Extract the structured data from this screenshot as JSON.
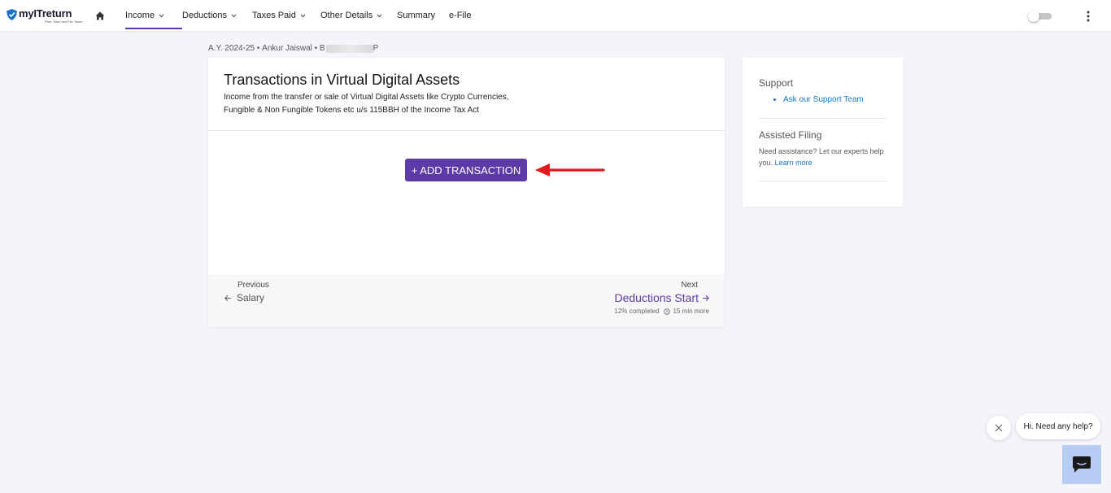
{
  "brand": {
    "name": "myITreturn",
    "tagline": "Plan, Save and File Taxes",
    "accent": "#5c3aa8"
  },
  "nav": {
    "home_icon": "home-icon",
    "items": [
      {
        "label": "Income",
        "dropdown": true,
        "active": true
      },
      {
        "label": "Deductions",
        "dropdown": true
      },
      {
        "label": "Taxes Paid",
        "dropdown": true
      },
      {
        "label": "Other Details",
        "dropdown": true
      },
      {
        "label": "Summary",
        "dropdown": false
      },
      {
        "label": "e-File",
        "dropdown": false
      }
    ],
    "toggle_on": false,
    "menu_icon": "more-vertical-icon"
  },
  "breadcrumb": {
    "year": "A.Y. 2024-25",
    "name": "Ankur Jaiswal",
    "pan_prefix": "B",
    "pan_suffix": "P"
  },
  "card": {
    "title": "Transactions in Virtual Digital Assets",
    "subtitle": "Income from the transfer or sale of Virtual Digital Assets like Crypto Currencies, Fungible & Non Fungible Tokens etc u/s 115BBH of the Income Tax Act",
    "add_button": "+ ADD TRANSACTION",
    "previous": {
      "label": "Previous",
      "link": "Salary"
    },
    "next": {
      "label": "Next",
      "link": "Deductions Start"
    },
    "progress": {
      "completed": "12% completed",
      "remaining": "15 min more"
    }
  },
  "side": {
    "support_heading": "Support",
    "support_link": "Ask our Support Team",
    "assisted_heading": "Assisted Filing",
    "assisted_text": "Need assistance? Let our experts help you.",
    "assisted_link": "Learn more"
  },
  "help": {
    "bubble_text": "Hi. Need any help?",
    "button_color": "#b7ccf2"
  }
}
